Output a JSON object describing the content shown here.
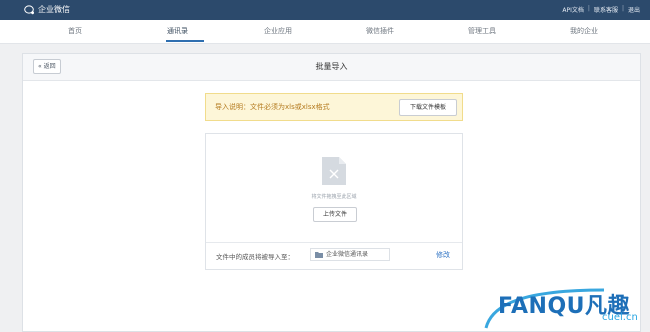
{
  "topbar": {
    "brand": "企业微信",
    "links": [
      "API文档",
      "联系客服",
      "退出"
    ],
    "separator": "|"
  },
  "nav": {
    "items": [
      "首页",
      "通讯录",
      "企业应用",
      "微信插件",
      "管理工具",
      "我的企业"
    ],
    "active": "通讯录"
  },
  "page": {
    "back_label": "返回",
    "title": "批量导入"
  },
  "notice": {
    "text": "导入说明：文件必须为xls或xlsx格式",
    "download_button": "下载文件模板"
  },
  "upload": {
    "drop_hint": "将文件拖拽至此区域",
    "upload_button": "上传文件",
    "destination_label": "文件中的成员将被导入至：",
    "destination_value": "企业微信通讯录",
    "edit_label": "修改"
  },
  "watermark": {
    "text": "FANQU凡趣",
    "sub": "cuel.cn"
  },
  "colors": {
    "topbar": "#2c4a6c",
    "accent": "#2f73c4",
    "notice_bg": "#fdf6d8",
    "notice_text": "#b47a1e"
  }
}
